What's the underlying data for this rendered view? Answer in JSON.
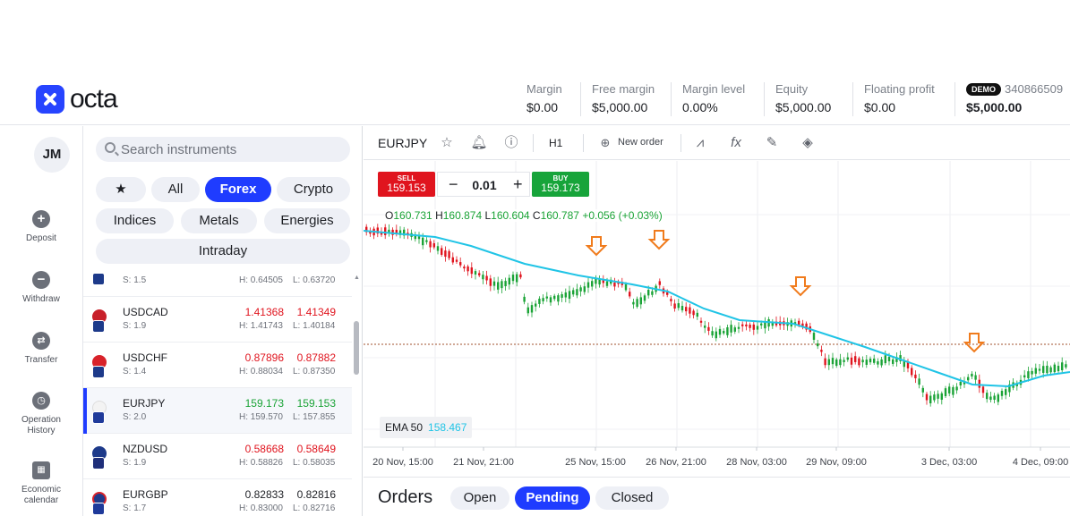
{
  "header": {
    "logo_text": "octa",
    "stats": [
      {
        "label": "Margin",
        "value": "$0.00"
      },
      {
        "label": "Free margin",
        "value": "$5,000.00"
      },
      {
        "label": "Margin level",
        "value": "0.00%"
      },
      {
        "label": "Equity",
        "value": "$5,000.00"
      },
      {
        "label": "Floating profit",
        "value": "$0.00"
      }
    ],
    "account": {
      "badge": "DEMO",
      "number": "340866509",
      "balance": "$5,000.00"
    }
  },
  "rail": {
    "avatar": "JM",
    "items": [
      {
        "label": "Deposit",
        "icon": "plus-circle-icon"
      },
      {
        "label": "Withdraw",
        "icon": "minus-circle-icon"
      },
      {
        "label": "Transfer",
        "icon": "transfer-icon"
      },
      {
        "label": "Operation History",
        "icon": "clock-icon"
      },
      {
        "label": "Economic calendar",
        "icon": "calendar-icon"
      }
    ]
  },
  "instruments": {
    "search_placeholder": "Search instruments",
    "filters": [
      "All",
      "Forex",
      "Crypto",
      "Indices",
      "Metals",
      "Energies",
      "Intraday"
    ],
    "active_filter": "Forex",
    "rows": [
      {
        "symbol": "",
        "spread": "S: 1.5",
        "bid": "",
        "ask": "",
        "high": "H: 0.64505",
        "low": "L: 0.63720",
        "dir": "dark"
      },
      {
        "symbol": "USDCAD",
        "spread": "S: 1.9",
        "bid": "1.41368",
        "ask": "1.41349",
        "high": "H: 1.41743",
        "low": "L: 1.40184",
        "dir": "red"
      },
      {
        "symbol": "USDCHF",
        "spread": "S: 1.4",
        "bid": "0.87896",
        "ask": "0.87882",
        "high": "H: 0.88034",
        "low": "L: 0.87350",
        "dir": "red"
      },
      {
        "symbol": "EURJPY",
        "spread": "S: 2.0",
        "bid": "159.173",
        "ask": "159.153",
        "high": "H: 159.570",
        "low": "L: 157.855",
        "dir": "green"
      },
      {
        "symbol": "NZDUSD",
        "spread": "S: 1.9",
        "bid": "0.58668",
        "ask": "0.58649",
        "high": "H: 0.58826",
        "low": "L: 0.58035",
        "dir": "red"
      },
      {
        "symbol": "EURGBP",
        "spread": "S: 1.7",
        "bid": "0.82833",
        "ask": "0.82816",
        "high": "H: 0.83000",
        "low": "L: 0.82716",
        "dir": "dark"
      }
    ]
  },
  "chart": {
    "symbol": "EURJPY",
    "timeframe": "H1",
    "new_order_label": "New order",
    "sell": {
      "label": "SELL",
      "price": "159.153"
    },
    "buy": {
      "label": "BUY",
      "price": "159.173"
    },
    "lot": "0.01",
    "minus": "−",
    "plus": "+",
    "ohlc": {
      "o_label": "O",
      "o": "160.731",
      "h_label": "H",
      "h": "160.874",
      "l_label": "L",
      "l": "160.604",
      "c_label": "C",
      "c": "160.787",
      "change": "+0.056 (+0.03%)"
    },
    "ema": {
      "label": "EMA 50",
      "value": "158.467"
    },
    "x_ticks": [
      "20 Nov, 15:00",
      "21 Nov, 21:00",
      "25 Nov, 15:00",
      "26 Nov, 21:00",
      "28 Nov, 03:00",
      "29 Nov, 09:00",
      "3 Dec, 03:00",
      "4 Dec, 09:00"
    ],
    "colors": {
      "up": "#1aa336",
      "down": "#e0141e",
      "ema": "#20c4e6",
      "arrow": "#f07b1c"
    }
  },
  "orders": {
    "title": "Orders",
    "tabs": [
      "Open",
      "Pending",
      "Closed"
    ],
    "active_tab": "Pending"
  }
}
